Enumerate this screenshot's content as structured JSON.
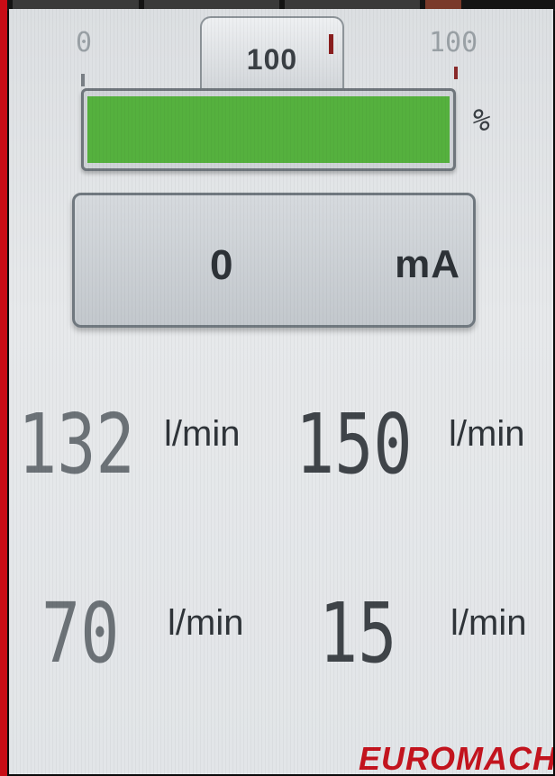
{
  "scale": {
    "min_label": "0",
    "max_label": "100"
  },
  "setpoint": {
    "value": "100"
  },
  "output_bar": {
    "level_percent": 100,
    "unit": "%",
    "color": "#55b13e"
  },
  "current": {
    "value": "0",
    "unit": "mA"
  },
  "flows": [
    {
      "value": "132",
      "unit": "l/min"
    },
    {
      "value": "150",
      "unit": "l/min"
    },
    {
      "value": "70",
      "unit": "l/min"
    },
    {
      "value": "15",
      "unit": "l/min"
    }
  ],
  "brand": {
    "logo_text": "EUROMACH",
    "color": "#c4141e"
  }
}
